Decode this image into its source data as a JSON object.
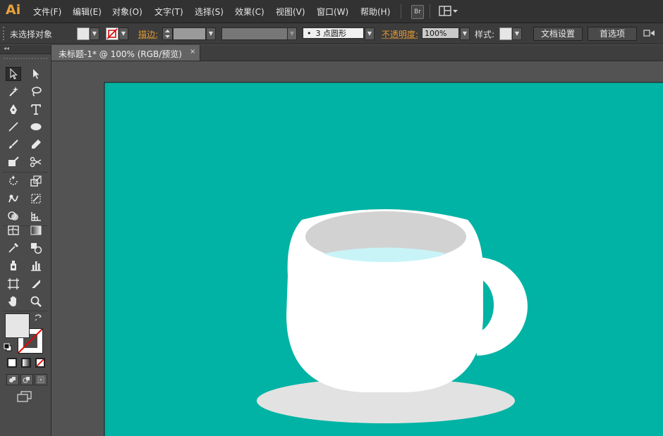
{
  "app": {
    "logo": "Ai"
  },
  "menu": {
    "items": [
      "文件(F)",
      "编辑(E)",
      "对象(O)",
      "文字(T)",
      "选择(S)",
      "效果(C)",
      "视图(V)",
      "窗口(W)",
      "帮助(H)"
    ],
    "bridge_button": "Br",
    "workspace_icon": "workspace-layout-icon"
  },
  "control_bar": {
    "selection_status": "未选择对象",
    "fill_color": "#e6e6e6",
    "stroke_label": "描边:",
    "brush_value": "3 点圆形",
    "brush_dot": "•",
    "opacity_label": "不透明度:",
    "opacity_value": "100%",
    "style_label": "样式:",
    "doc_setup_button": "文档设置",
    "preferences_button": "首选项"
  },
  "toolbox": {
    "collapse_glyph": "◂◂",
    "tools": [
      "selection-tool",
      "direct-selection-tool",
      "magic-wand-tool",
      "lasso-tool",
      "pen-tool",
      "type-tool",
      "line-segment-tool",
      "ellipse-tool",
      "paintbrush-tool",
      "pencil-tool",
      "blob-brush-tool",
      "scissors-tool",
      "rotate-tool",
      "scale-tool",
      "warp-tool",
      "free-transform-tool",
      "shape-builder-tool",
      "perspective-grid-tool",
      "mesh-tool",
      "gradient-tool",
      "eyedropper-tool",
      "blend-tool",
      "symbol-sprayer-tool",
      "column-graph-tool",
      "artboard-tool",
      "slice-tool",
      "hand-tool",
      "zoom-tool"
    ],
    "fill_swatch": "#e6e6e6",
    "stroke_swatch": "none"
  },
  "document": {
    "tab_title": "未标题-1* @ 100% (RGB/预览)",
    "close_glyph": "×"
  },
  "artwork": {
    "background_color": "#00b3a4",
    "saucer_color": "#e2e2e2",
    "cup_color": "#ffffff",
    "cup_interior_color": "#d2d2d2",
    "liquid_color": "#c8f4f8"
  }
}
